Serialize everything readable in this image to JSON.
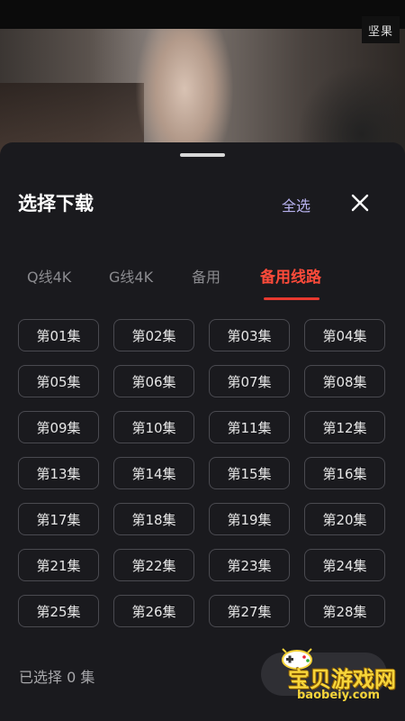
{
  "video": {
    "watermark": "坚果"
  },
  "sheet": {
    "title": "选择下载",
    "select_all": "全选",
    "close_icon": "close-icon"
  },
  "tabs": [
    {
      "label": "Q线4K",
      "active": false
    },
    {
      "label": "G线4K",
      "active": false
    },
    {
      "label": "备用",
      "active": false
    },
    {
      "label": "备用线路",
      "active": true
    }
  ],
  "episodes": [
    "第01集",
    "第02集",
    "第03集",
    "第04集",
    "第05集",
    "第06集",
    "第07集",
    "第08集",
    "第09集",
    "第10集",
    "第11集",
    "第12集",
    "第13集",
    "第14集",
    "第15集",
    "第16集",
    "第17集",
    "第18集",
    "第19集",
    "第20集",
    "第21集",
    "第22集",
    "第23集",
    "第24集",
    "第25集",
    "第26集",
    "第27集",
    "第28集"
  ],
  "footer": {
    "selected_text": "已选择 0 集"
  },
  "site_watermark": {
    "name": "宝贝游戏网",
    "url": "baobeiy.com"
  },
  "colors": {
    "accent": "#ff4b3a",
    "select_all": "#b7b1ee",
    "sheet_bg": "#1a1a1e"
  }
}
